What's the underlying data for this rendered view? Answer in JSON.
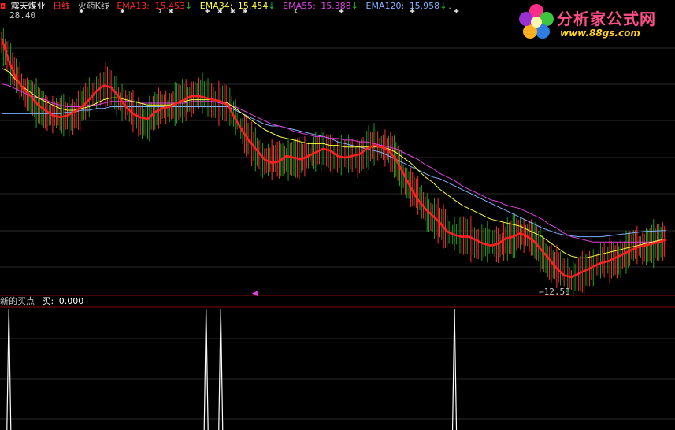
{
  "header": {
    "stock_name": "露天煤业",
    "period": "日线",
    "indicator_name": "火药K线",
    "ema13_label": "EMA13:",
    "ema13_value": "15.453",
    "ema34_label": "EMA34:",
    "ema34_value": "15.454",
    "ema55_label": "EMA55:",
    "ema55_value": "15.388",
    "ema120_label": "EMA120:",
    "ema120_value": "15.958",
    "dot": "."
  },
  "sub_header": {
    "indicator_name": "新的买点",
    "buy_label": "买:",
    "buy_value": "0.000"
  },
  "logo": {
    "name": "分析家公式网",
    "url": "www.88gs.com"
  },
  "price_labels": {
    "high": "28.40",
    "low": "←12.58"
  },
  "colors": {
    "ema13": "#ff2020",
    "ema34": "#ffff40",
    "ema55": "#e040e0",
    "ema120": "#80b0ff",
    "candle_up": "#ff3030",
    "candle_down": "#20a020",
    "signal": "#ffffff",
    "grid": "#2a2a2a",
    "divider": "#8a0000"
  },
  "chart_data": {
    "type": "line",
    "ylim": [
      12.58,
      28.4
    ],
    "series": [
      {
        "name": "EMA13",
        "values": [
          26.9,
          25.6,
          24.6,
          24.0,
          23.6,
          23.1,
          22.8,
          22.5,
          22.4,
          22.5,
          22.7,
          23.0,
          23.4,
          23.9,
          24.2,
          24.1,
          23.6,
          23.0,
          22.6,
          22.4,
          22.3,
          22.7,
          22.9,
          23.0,
          23.2,
          23.4,
          23.6,
          23.6,
          23.5,
          23.4,
          23.3,
          23.1,
          22.3,
          21.6,
          21.0,
          20.5,
          20.0,
          19.8,
          19.9,
          20.2,
          20.1,
          20.0,
          20.2,
          20.4,
          20.6,
          20.5,
          20.2,
          20.1,
          20.2,
          20.3,
          20.6,
          20.8,
          20.7,
          20.5,
          20.0,
          19.2,
          18.4,
          17.7,
          17.2,
          16.8,
          16.4,
          15.9,
          15.7,
          15.6,
          15.6,
          15.4,
          15.2,
          15.1,
          15.2,
          15.5,
          15.6,
          15.8,
          15.6,
          15.3,
          14.8,
          14.3,
          13.8,
          13.4,
          13.3,
          13.5,
          13.7,
          13.9,
          14.1,
          14.2,
          14.4,
          14.6,
          14.8,
          15.0,
          15.1,
          15.2,
          15.3,
          15.45
        ]
      },
      {
        "name": "EMA34",
        "values": [
          25.2,
          25.0,
          24.5,
          24.1,
          23.8,
          23.5,
          23.3,
          23.1,
          22.9,
          22.8,
          22.8,
          22.9,
          23.0,
          23.2,
          23.4,
          23.5,
          23.5,
          23.4,
          23.3,
          23.2,
          23.1,
          23.1,
          23.1,
          23.1,
          23.2,
          23.3,
          23.4,
          23.4,
          23.4,
          23.4,
          23.3,
          23.2,
          22.9,
          22.6,
          22.3,
          22.0,
          21.7,
          21.5,
          21.3,
          21.2,
          21.1,
          21.0,
          20.9,
          20.9,
          20.9,
          20.8,
          20.8,
          20.7,
          20.7,
          20.7,
          20.7,
          20.7,
          20.7,
          20.6,
          20.4,
          20.1,
          19.8,
          19.4,
          19.0,
          18.7,
          18.3,
          18.0,
          17.7,
          17.4,
          17.2,
          17.0,
          16.8,
          16.6,
          16.5,
          16.4,
          16.3,
          16.2,
          16.0,
          15.8,
          15.6,
          15.3,
          15.0,
          14.7,
          14.5,
          14.4,
          14.4,
          14.5,
          14.6,
          14.7,
          14.8,
          14.9,
          15.0,
          15.1,
          15.2,
          15.3,
          15.4,
          15.454
        ]
      },
      {
        "name": "EMA55",
        "values": [
          24.3,
          24.2,
          24.0,
          23.8,
          23.6,
          23.5,
          23.4,
          23.2,
          23.1,
          23.0,
          23.0,
          23.0,
          23.1,
          23.1,
          23.2,
          23.3,
          23.3,
          23.3,
          23.3,
          23.2,
          23.2,
          23.2,
          23.2,
          23.2,
          23.2,
          23.2,
          23.3,
          23.3,
          23.3,
          23.3,
          23.2,
          23.1,
          23.0,
          22.8,
          22.6,
          22.4,
          22.2,
          22.0,
          21.9,
          21.8,
          21.6,
          21.5,
          21.4,
          21.3,
          21.3,
          21.2,
          21.2,
          21.1,
          21.1,
          21.0,
          21.0,
          20.9,
          20.8,
          20.7,
          20.6,
          20.4,
          20.2,
          20.0,
          19.7,
          19.5,
          19.2,
          19.0,
          18.8,
          18.5,
          18.3,
          18.1,
          17.9,
          17.7,
          17.6,
          17.4,
          17.3,
          17.2,
          17.0,
          16.8,
          16.6,
          16.3,
          16.1,
          15.8,
          15.6,
          15.5,
          15.4,
          15.3,
          15.3,
          15.3,
          15.3,
          15.3,
          15.3,
          15.3,
          15.3,
          15.3,
          15.35,
          15.388
        ]
      },
      {
        "name": "EMA120",
        "values": [
          22.6,
          22.6,
          22.6,
          22.6,
          22.6,
          22.6,
          22.6,
          22.6,
          22.6,
          22.7,
          22.7,
          22.8,
          22.8,
          22.9,
          22.9,
          23.0,
          23.0,
          23.0,
          23.0,
          23.0,
          23.0,
          23.0,
          23.0,
          23.0,
          23.0,
          23.0,
          23.0,
          23.0,
          23.0,
          23.0,
          23.0,
          23.0,
          22.8,
          22.6,
          22.4,
          22.2,
          22.0,
          21.9,
          21.9,
          21.8,
          21.7,
          21.6,
          21.5,
          21.4,
          21.3,
          21.2,
          21.0,
          20.9,
          20.8,
          20.7,
          20.6,
          20.5,
          20.4,
          20.2,
          20.0,
          19.8,
          19.6,
          19.4,
          19.2,
          19.0,
          18.9,
          18.7,
          18.5,
          18.3,
          18.1,
          17.9,
          17.7,
          17.5,
          17.3,
          17.1,
          16.9,
          16.7,
          16.5,
          16.3,
          16.1,
          15.95,
          15.8,
          15.7,
          15.65,
          15.6,
          15.6,
          15.6,
          15.6,
          15.65,
          15.7,
          15.75,
          15.8,
          15.85,
          15.9,
          15.92,
          15.94,
          15.958
        ]
      }
    ],
    "buy_signals": [
      1,
      28,
      30,
      62
    ]
  }
}
